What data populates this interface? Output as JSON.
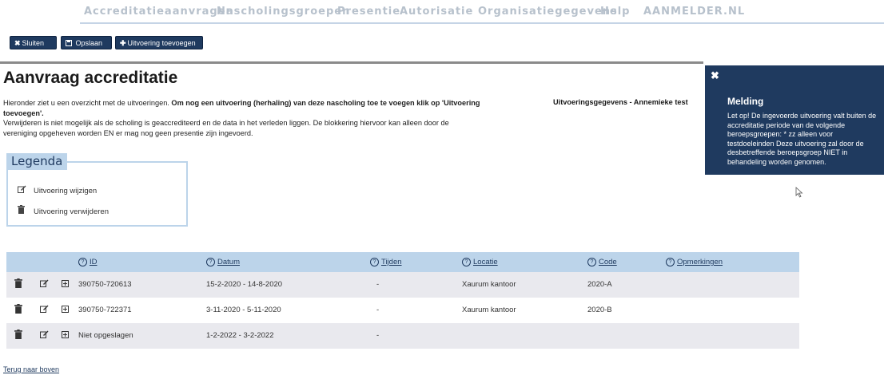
{
  "nav": {
    "items": [
      "Accreditatieaanvragen",
      "Nascholingsgroepen",
      "Presentie",
      "Autorisatie",
      "Organisatiegegevens",
      "Help",
      "AANMELDER.NL"
    ]
  },
  "toolbar": {
    "close_label": "Sluiten",
    "save_label": "Opslaan",
    "add_label": "Uitvoering toevoegen"
  },
  "page": {
    "title": "Aanvraag accreditatie",
    "intro_1a": "Hieronder ziet u een overzicht met de uitvoeringen. ",
    "intro_1b": "Om nog een uitvoering (herhaling) van deze nascholing toe te voegen klik op 'Uitvoering toevoegen'.",
    "intro_2": "Verwijderen is niet mogelijk als de scholing is geaccrediteerd en de data in het verleden liggen. De blokkering hiervoor kan alleen door de vereniging opgeheven worden EN er mag nog geen presentie zijn ingevoerd.",
    "sub_right": "Uitvoeringsgegevens - Annemieke test"
  },
  "legend": {
    "title": "Legenda",
    "edit_label": "Uitvoering wijzigen",
    "delete_label": "Uitvoering verwijderen"
  },
  "notification": {
    "title": "Melding",
    "body": "Let op! De ingevoerde uitvoering valt buiten de accreditatie periode van de volgende beroepsgroepen: * zz alleen voor testdoeleinden Deze uitvoering zal door de desbetreffende beroepsgroep NIET in behandeling worden genomen."
  },
  "table": {
    "headers": [
      "ID",
      "Datum",
      "Tijden",
      "Locatie",
      "Code",
      "Opmerkingen"
    ],
    "rows": [
      {
        "id": "390750-720613",
        "datum": "15-2-2020 - 14-8-2020",
        "tijden": "-",
        "locatie": "Xaurum kantoor",
        "code": "2020-A",
        "opmerkingen": ""
      },
      {
        "id": "390750-722371",
        "datum": "3-11-2020 - 5-11-2020",
        "tijden": "-",
        "locatie": "Xaurum kantoor",
        "code": "2020-B",
        "opmerkingen": ""
      },
      {
        "id": "Niet opgeslagen",
        "datum": "1-2-2022 - 3-2-2022",
        "tijden": "-",
        "locatie": "",
        "code": "",
        "opmerkingen": ""
      }
    ]
  },
  "footer": {
    "back_link": "Terug naar boven"
  },
  "icons": {
    "close": "close-icon",
    "save": "floppy-icon",
    "add": "plus-icon",
    "edit": "edit-icon",
    "delete": "trash-icon",
    "expand": "expand-icon",
    "help": "help-icon"
  },
  "colors": {
    "primary": "#1f3a5f",
    "table_header": "#bcd4ea",
    "row_alt": "#e9e9ee",
    "nav_text": "#b7c1cc"
  }
}
